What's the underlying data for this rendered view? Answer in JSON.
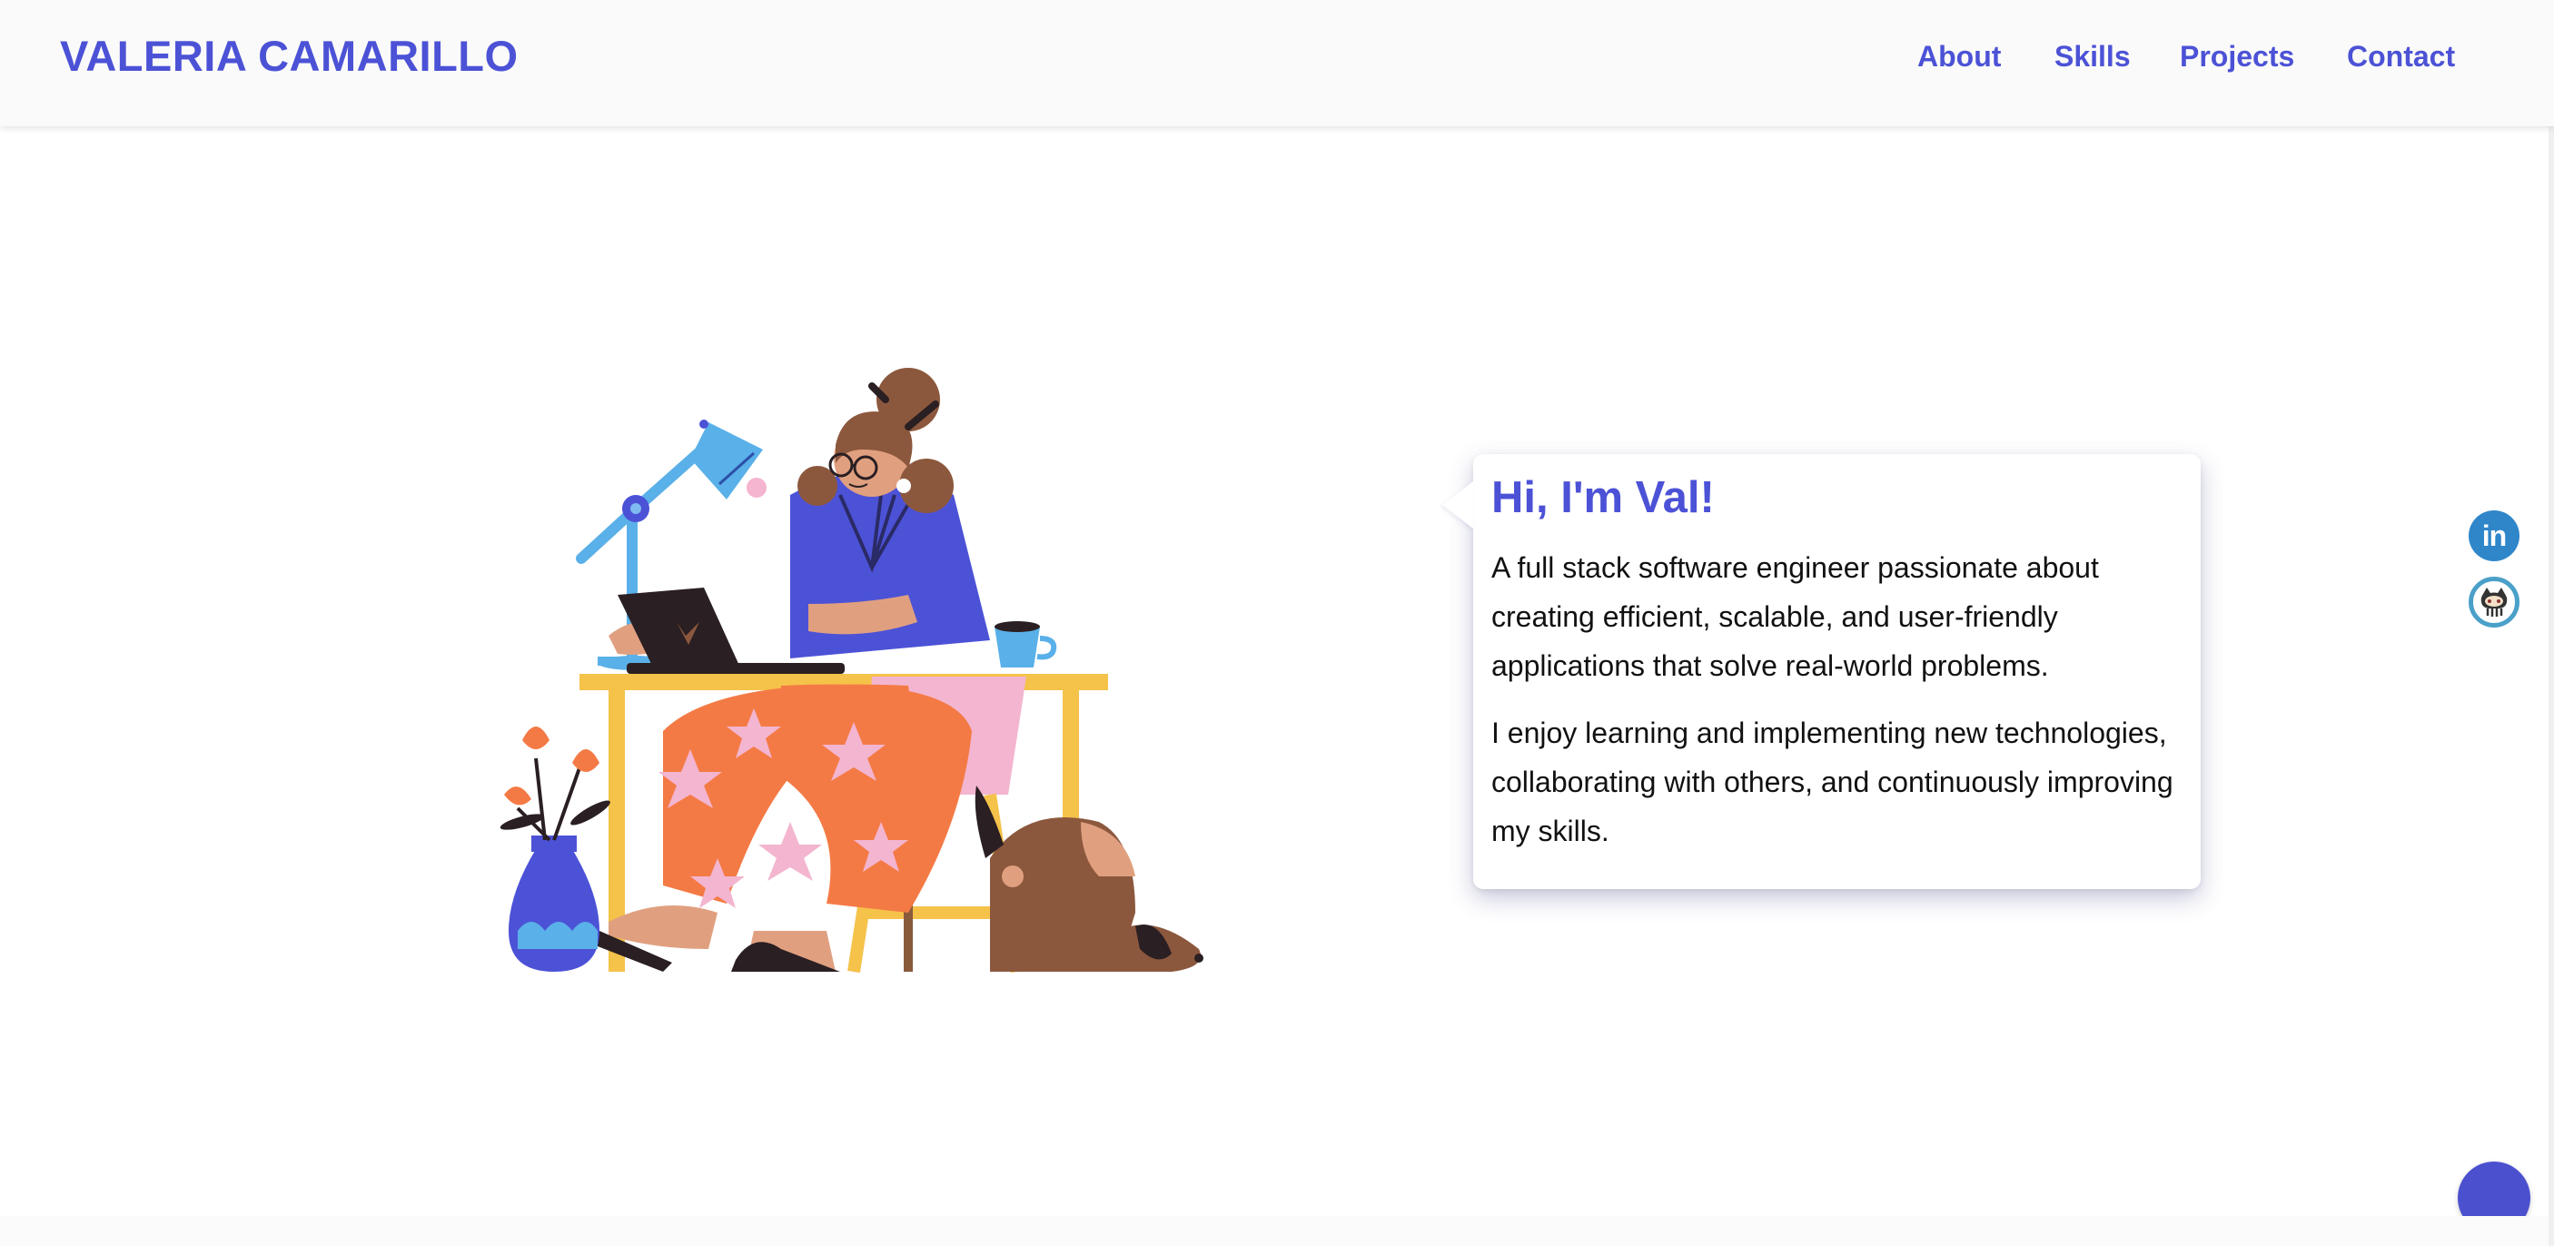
{
  "brand": {
    "name": "VALERIA CAMARILLO"
  },
  "nav": {
    "about": "About",
    "skills": "Skills",
    "projects": "Projects",
    "contact": "Contact"
  },
  "hero": {
    "greeting": "Hi, I'm Val!",
    "paragraph1": "A full stack software engineer passionate about creating efficient, scalable, and user-friendly applications that solve real-world problems.",
    "paragraph2": "I enjoy learning and implementing new technologies, collaborating with others, and continuously improving my skills."
  },
  "social": {
    "linkedin_text": "in",
    "linkedin_icon": "linkedin-icon",
    "github_icon": "github-octocat-icon"
  },
  "colors": {
    "accent": "#4c52d6",
    "linkedin": "#2f86c9",
    "github_ring": "#4aa0c8"
  }
}
